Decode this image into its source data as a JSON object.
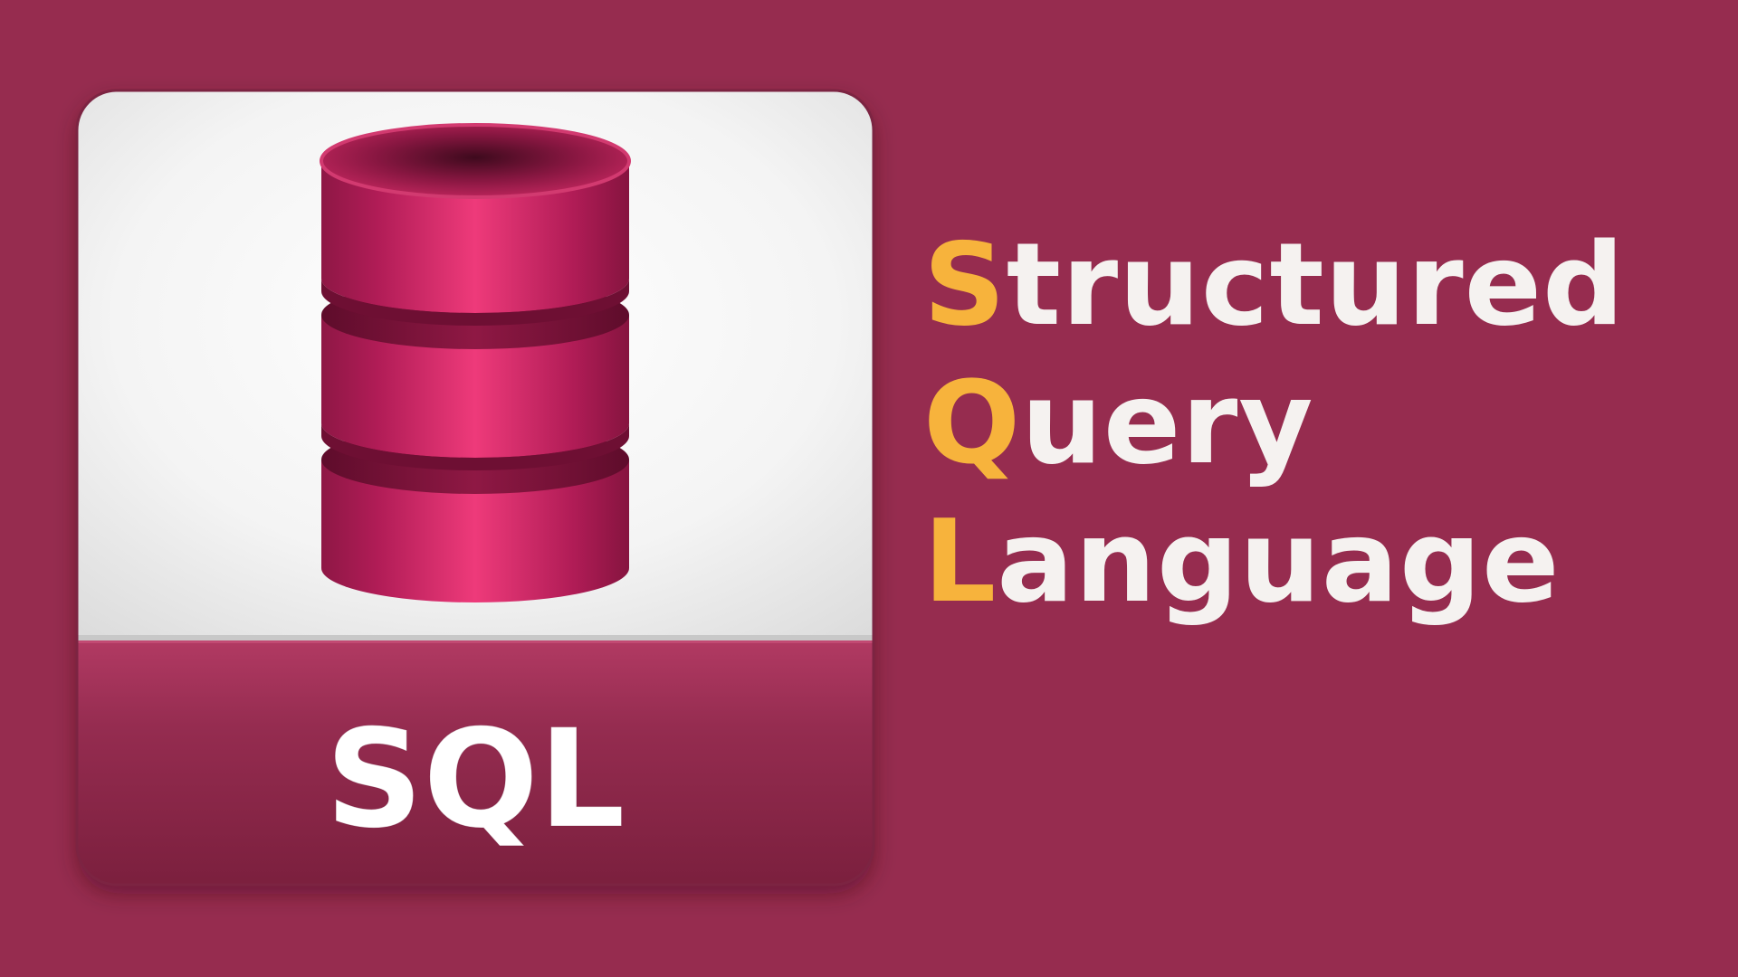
{
  "colors": {
    "background": "#962c4f",
    "accent_letter": "#f7b33c",
    "headline_text": "#f5f2f0",
    "icon_panel": "#f4f4f4",
    "icon_band": "#9a2f55",
    "database_cylinder": "#c2225f"
  },
  "icon": {
    "name": "database-file-icon",
    "label": "SQL"
  },
  "headline": [
    {
      "initial": "S",
      "rest": "tructured"
    },
    {
      "initial": "Q",
      "rest": "uery"
    },
    {
      "initial": "L",
      "rest": "anguage"
    }
  ]
}
